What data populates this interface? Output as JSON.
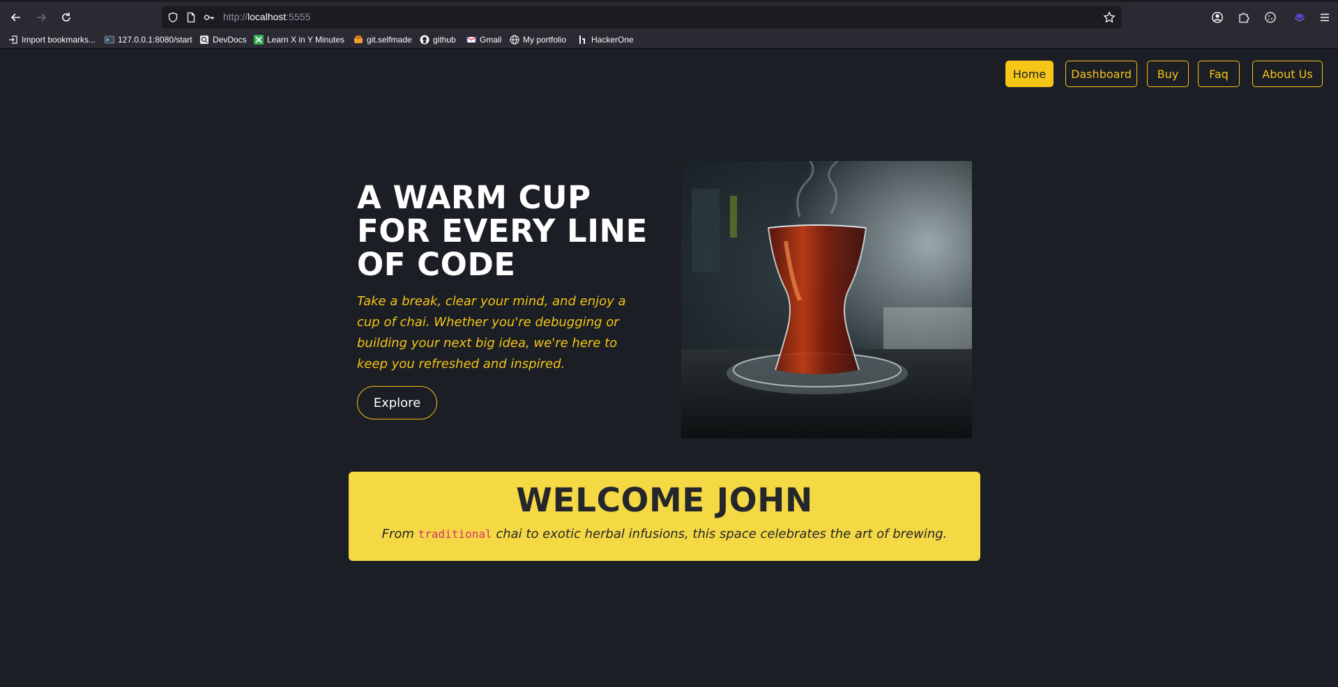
{
  "browser": {
    "url_prefix": "http://",
    "url_host": "localhost",
    "url_port": ":5555",
    "bookmarks": [
      {
        "label": "Import bookmarks...",
        "icon": "import-icon"
      },
      {
        "label": "127.0.0.1:8080/start",
        "icon": "terminal-icon"
      },
      {
        "label": "DevDocs",
        "icon": "devdocs-icon"
      },
      {
        "label": "Learn X in Y Minutes",
        "icon": "learnx-icon"
      },
      {
        "label": "git.selfmade",
        "icon": "git-icon"
      },
      {
        "label": "github",
        "icon": "github-icon"
      },
      {
        "label": "Gmail",
        "icon": "gmail-icon"
      },
      {
        "label": "My portfolio",
        "icon": "globe-icon"
      },
      {
        "label": "HackerOne",
        "icon": "hackerone-icon"
      }
    ]
  },
  "nav": {
    "items": [
      {
        "label": "Home",
        "active": true
      },
      {
        "label": "Dashboard",
        "active": false
      },
      {
        "label": "Buy",
        "active": false
      },
      {
        "label": "Faq",
        "active": false
      },
      {
        "label": "About Us",
        "active": false
      }
    ]
  },
  "hero": {
    "title_line1": "A WARM CUP",
    "title_line2": "FOR EVERY LINE",
    "title_line3": "OF CODE",
    "subtitle": "Take a break, clear your mind, and enjoy a cup of chai. Whether you're debugging or building your next big idea, we're here to keep you refreshed and inspired.",
    "cta_label": "Explore"
  },
  "welcome": {
    "heading": "WELCOME JOHN",
    "text_before": "From ",
    "code_word": "traditional",
    "text_after": " chai to exotic herbal infusions, this space celebrates the art of brewing."
  },
  "colors": {
    "background": "#1b1e24",
    "accent": "#f5c518",
    "welcome_bg": "#f4d944",
    "code": "#d6336c"
  }
}
